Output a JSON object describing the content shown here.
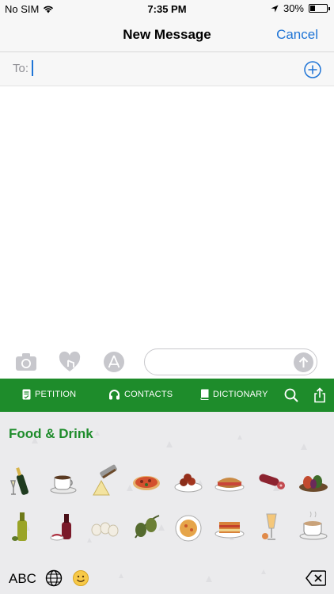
{
  "status_bar": {
    "carrier": "No SIM",
    "time": "7:35 PM",
    "battery": "30%",
    "battery_fraction": 0.3
  },
  "nav": {
    "title": "New Message",
    "cancel": "Cancel"
  },
  "recipient": {
    "label": "To:"
  },
  "keyboard_toolbar": {
    "tabs": [
      {
        "label": "PETITION",
        "icon": "petition-icon"
      },
      {
        "label": "CONTACTS",
        "icon": "headphones-icon"
      },
      {
        "label": "DICTIONARY",
        "icon": "book-icon"
      }
    ],
    "tools": [
      "search-icon",
      "share-icon"
    ]
  },
  "keyboard": {
    "category": "Food & Drink",
    "stickers": [
      "champagne-sticker",
      "coffee-cup-sticker",
      "cheese-grater-sticker",
      "pizza-sticker",
      "meatballs-sticker",
      "sandwich-sticker",
      "salami-sticker",
      "grilled-vegetables-sticker",
      "olive-oil-sticker",
      "vinegar-bottle-sticker",
      "garlic-sticker",
      "olives-sticker",
      "risotto-sticker",
      "lasagna-sticker",
      "cocktail-sticker",
      "cappuccino-sticker"
    ],
    "abc_label": "ABC"
  },
  "colors": {
    "accent": "#1e74d6",
    "toolbar": "#1e8c2b",
    "category_title": "#1e8c2b"
  }
}
